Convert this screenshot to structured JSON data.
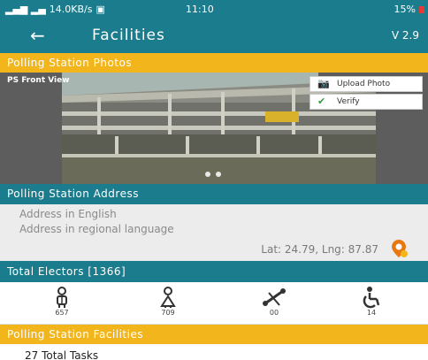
{
  "status_bar": {
    "signal": "▂▄▆ ▂▄",
    "speed": "14.0KB/s",
    "time": "11:10",
    "battery": "15%"
  },
  "app_bar": {
    "title": "Facilities",
    "version": "V 2.9"
  },
  "photos_section": {
    "header": "Polling Station Photos",
    "photo_label": "PS Front View",
    "upload_label": "Upload Photo",
    "verify_label": "Verify"
  },
  "address_section": {
    "header": "Polling Station Address",
    "english": "Address in English",
    "regional": "Address in regional language",
    "latlng": "Lat: 24.79, Lng: 87.87"
  },
  "electors": {
    "header": "Total Electors [1366]",
    "male_count": "657",
    "female_count": "709",
    "third_gender_count": "00",
    "pwd_count": "14"
  },
  "facilities_section": {
    "header": "Polling Station Facilities",
    "tasks": "27 Total Tasks"
  },
  "colors": {
    "teal": "#1a7c8c",
    "yellow": "#f2b51b",
    "verify_green": "#2e9e3f",
    "pin_orange": "#e8780f"
  }
}
